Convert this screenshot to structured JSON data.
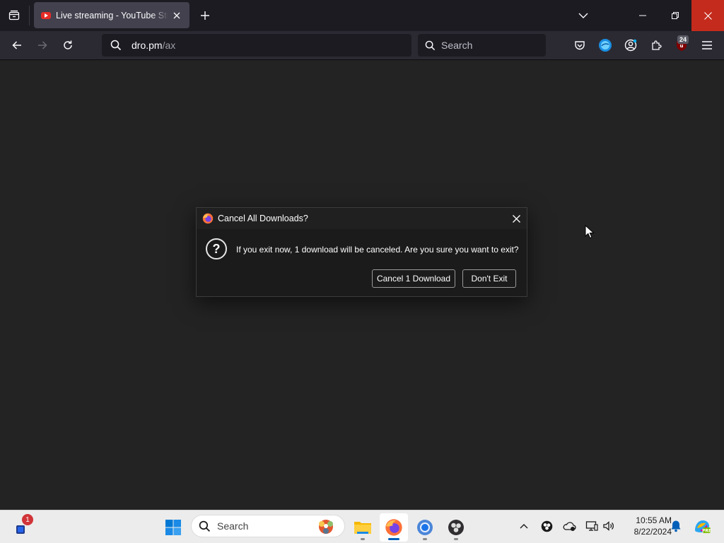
{
  "browser": {
    "tab": {
      "title": "Live streaming - YouTube Studio",
      "favicon": "youtube-icon"
    },
    "url": {
      "host": "dro.pm",
      "path": "/ax"
    },
    "search_placeholder": "Search",
    "ublock_badge": "24"
  },
  "dialog": {
    "title": "Cancel All Downloads?",
    "message": "If you exit now, 1 download will be canceled. Are you sure you want to exit?",
    "question_glyph": "?",
    "buttons": {
      "cancel": "Cancel 1 Download",
      "dont_exit": "Don't Exit"
    }
  },
  "taskbar": {
    "widgets_badge": "1",
    "search_placeholder": "Search",
    "apps": [
      "file-explorer",
      "firefox",
      "chrome",
      "obs-studio"
    ],
    "active_app": "firefox",
    "clock": {
      "time": "10:55 AM",
      "date": "8/22/2024"
    }
  },
  "colors": {
    "accent": "#005fb8",
    "close_red": "#c42b1c",
    "content_bg": "#232323"
  }
}
